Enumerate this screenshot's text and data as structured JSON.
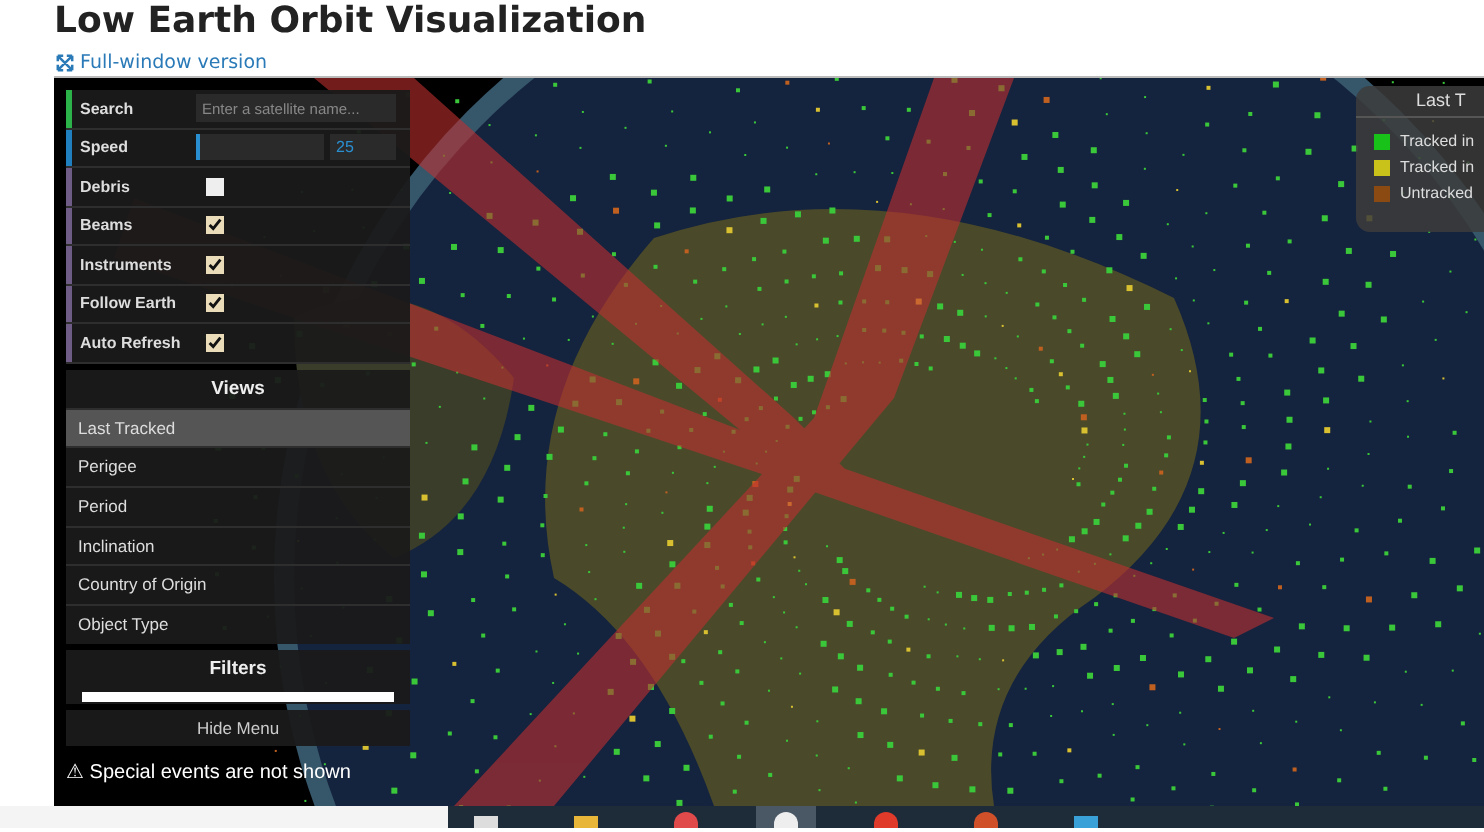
{
  "page": {
    "title": "Low Earth Orbit Visualization",
    "link": "Full-window version"
  },
  "menu": {
    "controls": [
      {
        "kind": "search",
        "label": "Search",
        "placeholder": "Enter a satellite name...",
        "color": "#2bb34a"
      },
      {
        "kind": "slider",
        "label": "Speed",
        "value": "25",
        "level": 0.02,
        "color": "#1f7fbf"
      },
      {
        "kind": "checkbox",
        "label": "Debris",
        "checked": false,
        "color": "#6e5b86"
      },
      {
        "kind": "checkbox",
        "label": "Beams",
        "checked": true,
        "color": "#6e5b86"
      },
      {
        "kind": "checkbox",
        "label": "Instruments",
        "checked": true,
        "color": "#6e5b86"
      },
      {
        "kind": "checkbox",
        "label": "Follow Earth",
        "checked": true,
        "color": "#6e5b86"
      },
      {
        "kind": "checkbox",
        "label": "Auto Refresh",
        "checked": true,
        "color": "#6e5b86"
      }
    ],
    "views_title": "Views",
    "views": [
      {
        "label": "Last Tracked",
        "selected": true
      },
      {
        "label": "Perigee",
        "selected": false
      },
      {
        "label": "Period",
        "selected": false
      },
      {
        "label": "Inclination",
        "selected": false
      },
      {
        "label": "Country of Origin",
        "selected": false
      },
      {
        "label": "Object Type",
        "selected": false
      }
    ],
    "filters_title": "Filters",
    "hide_button": "Hide Menu"
  },
  "warning": "⚠ Special events are not shown",
  "legend": {
    "title": "Last T",
    "items": [
      {
        "label": "Tracked in",
        "color": "#19c219"
      },
      {
        "label": "Tracked in",
        "color": "#c8c21a"
      },
      {
        "label": "Untracked",
        "color": "#8a4a12"
      }
    ]
  },
  "taskbar": {
    "apps": [
      {
        "kind": "tasks",
        "active": false
      },
      {
        "kind": "folder",
        "active": false
      },
      {
        "kind": "chat",
        "active": false
      },
      {
        "kind": "face",
        "active": true
      },
      {
        "kind": "red",
        "active": false
      },
      {
        "kind": "firefox",
        "active": false
      },
      {
        "kind": "monitor",
        "active": false
      }
    ]
  }
}
